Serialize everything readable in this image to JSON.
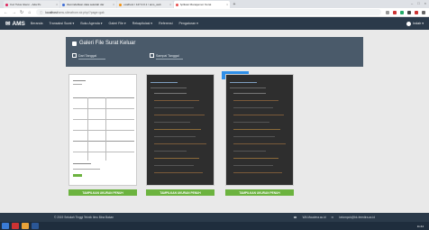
{
  "browser": {
    "tabs": [
      {
        "title": "Yuvi Tulus Glenn - Ada Pu",
        "color": "#e0245e"
      },
      {
        "title": "Memindahkan data sekolah dar",
        "color": "#3b6bd6"
      },
      {
        "title": "localhost / 127.0.0.1 / ams_web",
        "color": "#f29111"
      },
      {
        "title": "Aplikasi Manajemen Surat",
        "color": "#e84e4e"
      }
    ],
    "url_host": "localhost",
    "url_path": "/ams-slimafrom.sir.php/?page=gak"
  },
  "navbar": {
    "brand": "AMS",
    "menu": [
      "Beranda",
      "Transaksi Surat ▾",
      "Buku Agenda ▾",
      "Galeri File ▾",
      "Referensi",
      "Pengaturan ▾"
    ],
    "menu_extra": "Rekapitulasi ▾",
    "user": "Indah ▾"
  },
  "header": {
    "title": "Galeri File Surat Keluar",
    "date_from": "Dari Tanggal",
    "date_to": "Sampai Tanggal",
    "filter_label": "FILTER ☰"
  },
  "cards": [
    {
      "style": "white",
      "button": "TAMPILKAN UKURAN PENUH"
    },
    {
      "style": "dark",
      "button": "TAMPILKAN UKURAN PENUH"
    },
    {
      "style": "dark",
      "button": "TAMPILKAN UKURAN PENUH"
    }
  ],
  "footer": {
    "left": "© 2019 Sekolah Tinggi Teknik Ilmu Bina Bakan",
    "right1": "WA Maudera.ac.id",
    "right2": "kelompok@bk-feredira.ac.id"
  },
  "taskbar": {
    "clock": "11:44"
  }
}
